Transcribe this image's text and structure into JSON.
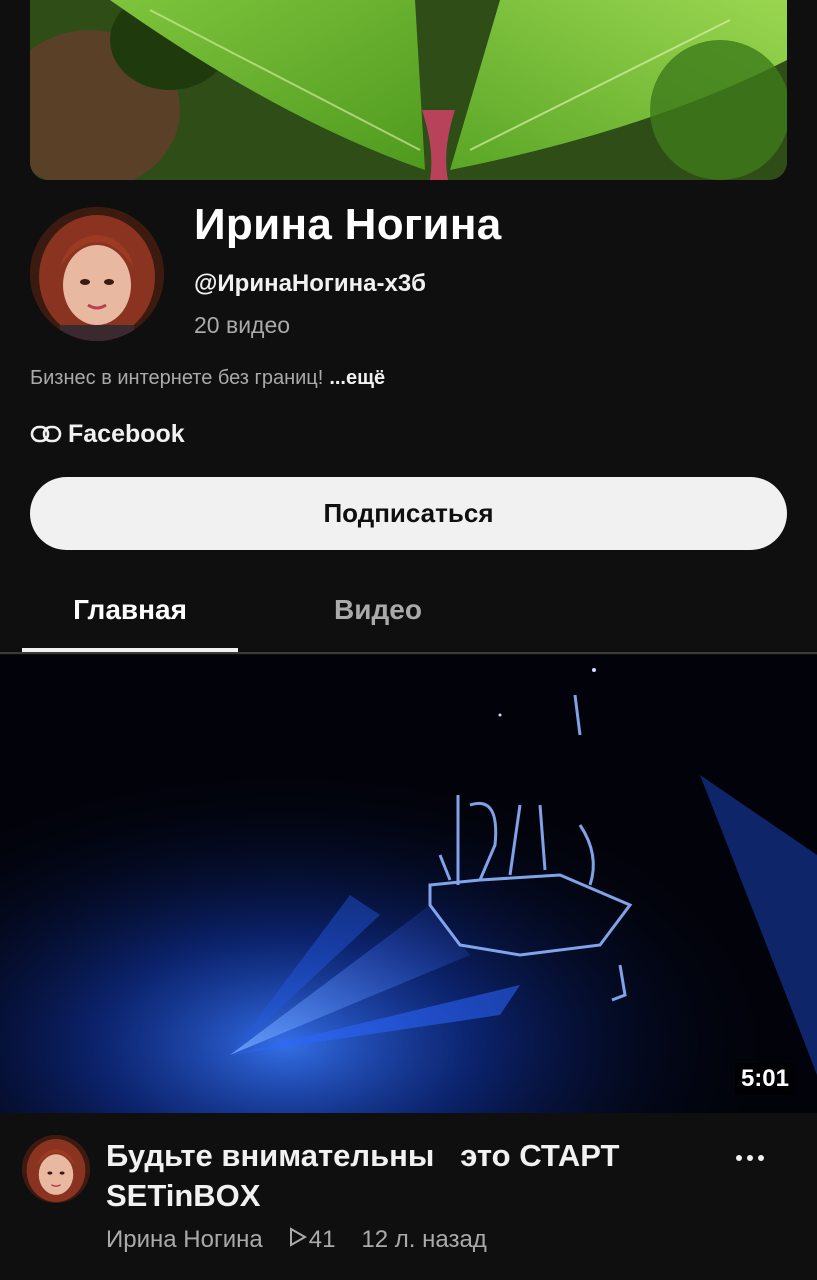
{
  "channel": {
    "name": "Ирина Ногина",
    "handle": "@ИринаНогина-х3б",
    "video_count": "20 видео",
    "description": "Бизнес в интернете без границ!",
    "description_more": "...ещё",
    "link_label": "Facebook",
    "subscribe_label": "Подписаться"
  },
  "tabs": [
    {
      "label": "Главная",
      "selected": true
    },
    {
      "label": "Видео",
      "selected": false
    }
  ],
  "featured_video": {
    "title": "Будьте внимательны   это СТАРТ SETinBOX",
    "duration": "5:01",
    "author": "Ирина Ногина",
    "views": "41",
    "age": "12 л. назад"
  },
  "icons": {
    "link": "link-icon",
    "more": "more-vert-icon",
    "views": "play-outline-icon"
  },
  "colors": {
    "background": "#0f0f0f",
    "primary_text": "#f1f1f1",
    "secondary_text": "#aaaaaa",
    "button_bg": "#f1f1f1",
    "laser_blue": "#1e64ff"
  }
}
